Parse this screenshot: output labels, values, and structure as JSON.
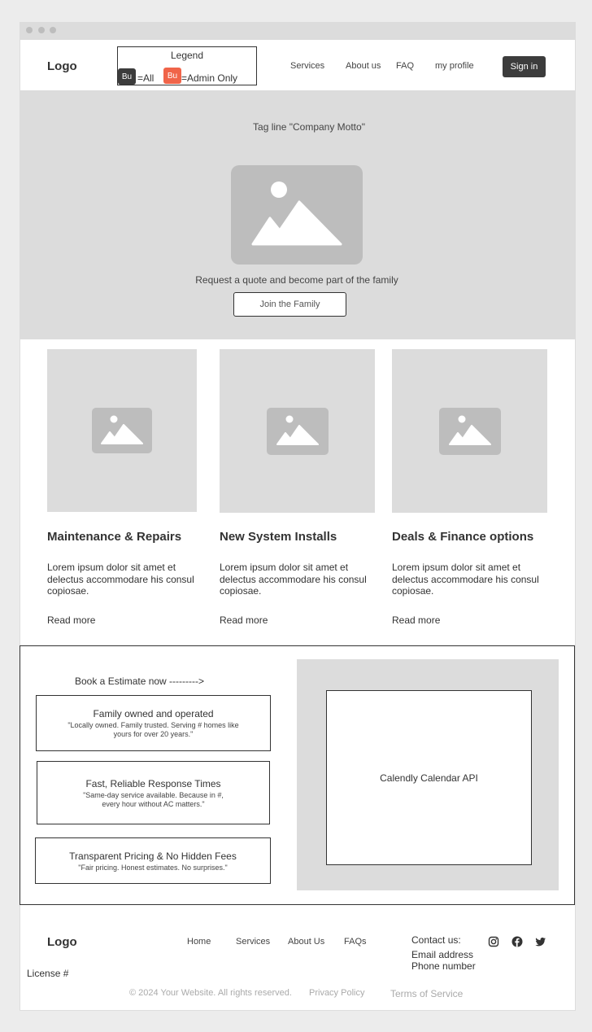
{
  "header": {
    "logo": "Logo",
    "legend": {
      "title": "Legend",
      "items": [
        {
          "chip": "Bu",
          "label": "=All",
          "color": "#3c3c3c"
        },
        {
          "chip": "Bu",
          "label": "=Admin Only",
          "color": "#f06449"
        }
      ]
    },
    "nav": [
      "Services",
      "About us",
      "FAQ",
      "my profile"
    ],
    "sign_in": "Sign in"
  },
  "hero": {
    "tagline": "Tag line \"Company Motto\"",
    "cta_text": "Request a quote and become part of the family",
    "button": "Join the Family"
  },
  "cards": [
    {
      "title": "Maintenance & Repairs",
      "body": "Lorem ipsum dolor sit amet et delectus accommodare his consul copiosae.",
      "link": "Read more"
    },
    {
      "title": "New System Installs",
      "body": "Lorem ipsum dolor sit amet et delectus accommodare his consul copiosae.",
      "link": "Read more"
    },
    {
      "title": "Deals & Finance options",
      "body": "Lorem ipsum dolor sit amet et delectus accommodare his consul copiosae.",
      "link": "Read more"
    }
  ],
  "booking": {
    "heading": "Book a Estimate now --------->",
    "features": [
      {
        "title": "Family owned and operated",
        "subtitle": "\"Locally owned. Family trusted. Serving # homes like yours for over 20 years.\""
      },
      {
        "title": "Fast, Reliable Response Times",
        "subtitle": "\"Same-day service available. Because in #, every hour without AC matters.\""
      },
      {
        "title": "Transparent Pricing & No Hidden Fees",
        "subtitle": "\"Fair pricing. Honest estimates. No surprises.\""
      }
    ],
    "calendar": "Calendly Calendar API"
  },
  "footer": {
    "logo": "Logo",
    "links": [
      "Home",
      "Services",
      "About Us",
      "FAQs"
    ],
    "contact": {
      "label": "Contact us:",
      "email": "Email address",
      "phone": "Phone number"
    },
    "social_icons": [
      "instagram-icon",
      "facebook-icon",
      "twitter-icon"
    ],
    "license": "License #",
    "copyright": "© 2024 Your Website. All rights reserved.",
    "privacy": "Privacy Policy",
    "terms": "Terms of Service"
  },
  "colors": {
    "dark_button": "#3c3c3c",
    "admin_accent": "#f06449",
    "placeholder_bg": "#dcdcdc",
    "placeholder_icon": "#bdbdbd"
  }
}
